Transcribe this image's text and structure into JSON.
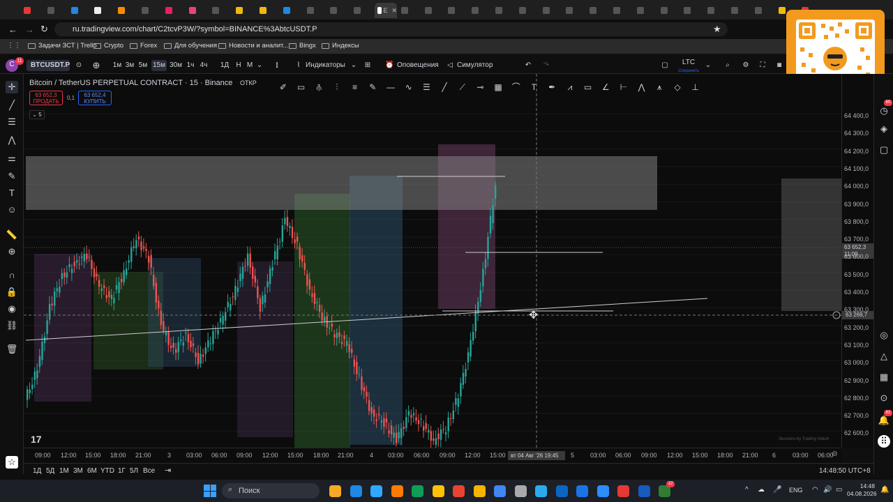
{
  "browser": {
    "url": "ru.tradingview.com/chart/C2tcvP3W/?symbol=BINANCE%3AbtcUSDT.P",
    "tab_count": 34,
    "active_tab_label": "E",
    "bookmarks": [
      "Задачи ЗСТ | Trello",
      "Crypto",
      "Forex",
      "Для обучения",
      "Новости и аналит...",
      "Bingx",
      "Индексы"
    ]
  },
  "tv_header": {
    "symbol": "BTCUSDT.P",
    "notif_badge": "11",
    "intervals": [
      "1м",
      "3м",
      "5м",
      "15м",
      "30м",
      "1ч",
      "4ч",
      "1Д",
      "Н",
      "М"
    ],
    "active_interval": "15м",
    "indicators": "Индикаторы",
    "alerts": "Оповещения",
    "replay": "Симулятор рынка",
    "layout_name": "LTC",
    "layout_sub": "Сохранить"
  },
  "legend": {
    "title": "Bitcoin / TetherUS PERPETUAL CONTRACT · 15 · Binance",
    "open_label": "ОТКР",
    "sell_price": "63 652,3",
    "sell_label": "ПРОДАТЬ",
    "spread": "0,1",
    "buy_price": "63 652,4",
    "buy_label": "КУПИТЬ",
    "indicators_count": "5"
  },
  "price_scale": {
    "ticks": [
      "64 400,0",
      "64 300,0",
      "64 200,0",
      "64 100,0",
      "64 000,0",
      "63 900,0",
      "63 800,0",
      "63 700,0",
      "63 600,0",
      "63 500,0",
      "63 400,0",
      "63 300,0",
      "63 200,0",
      "63 100,0",
      "63 000,0",
      "62 900,0",
      "62 800,0",
      "62 700,0",
      "62 600,0"
    ],
    "last_price": "63 652,3",
    "countdown": "11:09",
    "crosshair_price": "63 269,7"
  },
  "time_scale": {
    "ticks": [
      "09:00",
      "12:00",
      "15:00",
      "18:00",
      "21:00",
      "3",
      "03:00",
      "06:00",
      "09:00",
      "12:00",
      "15:00",
      "18:00",
      "21:00",
      "4",
      "03:00",
      "06:00",
      "09:00",
      "12:00",
      "15:00",
      "5",
      "03:00",
      "06:00",
      "09:00",
      "12:00",
      "15:00",
      "18:00",
      "21:00",
      "6",
      "03:00",
      "06:00"
    ],
    "crosshair_label": "вт 04 Авг '26   19:45"
  },
  "bottom": {
    "ranges": [
      "1Д",
      "5Д",
      "1М",
      "3М",
      "6М",
      "YTD",
      "1Г",
      "5Л",
      "Все"
    ],
    "clock": "14:48:50 UTC+8",
    "watermark": "Sessions by Trading Volum"
  },
  "right_badges": {
    "top": "60",
    "bottom": "82"
  },
  "taskbar": {
    "search": "Поиск",
    "lang": "ENG",
    "time": "14:48",
    "date": "04.08.2026",
    "badge": "12"
  },
  "colors": {
    "up": "#26a69a",
    "down": "#ef5350",
    "bg": "#0c0c0c",
    "accent": "#2962ff"
  }
}
